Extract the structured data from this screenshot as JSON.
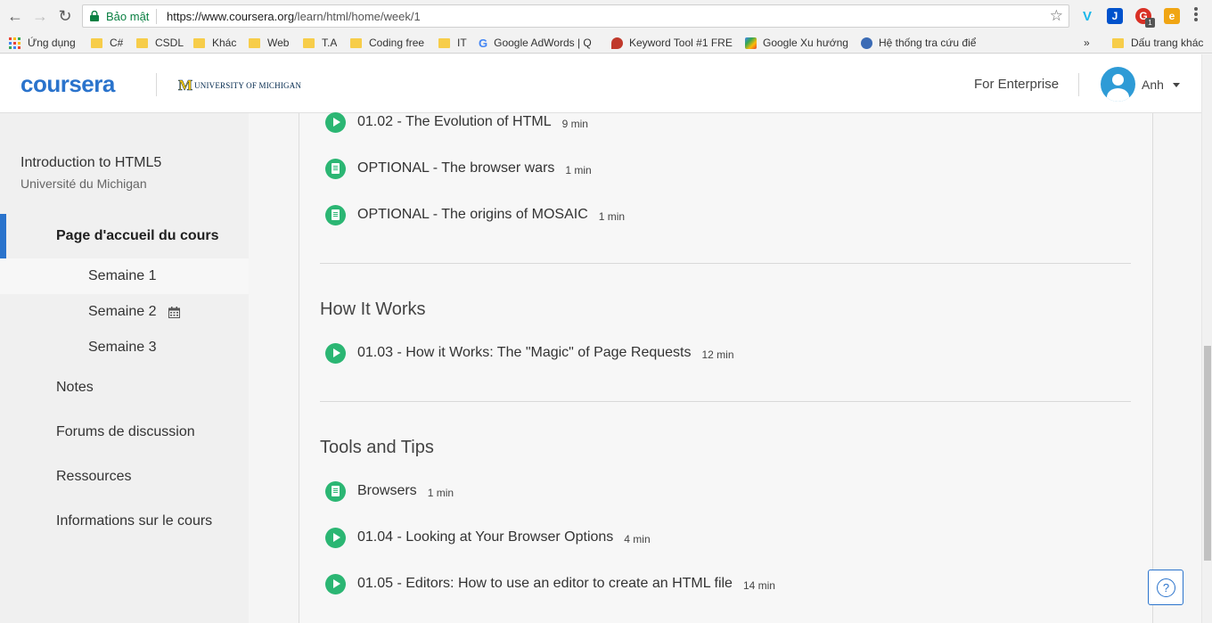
{
  "browser": {
    "secure_label": "Bảo mật",
    "url_host": "https://www.coursera.org",
    "url_path": "/learn/html/home/week/1",
    "extensions": [
      {
        "name": "vimeo",
        "letter": "V",
        "color": "#1ab7ea"
      },
      {
        "name": "jira",
        "letter": "J",
        "color": "#0052cc"
      },
      {
        "name": "pdf",
        "letter": "G",
        "color": "#d93025",
        "badge": "1"
      },
      {
        "name": "evernote",
        "letter": "e",
        "color": "#f0a513"
      }
    ]
  },
  "bookmarks": {
    "apps": "Ứng dụng",
    "items": [
      "C#",
      "CSDL",
      "Khác",
      "Web",
      "T.A",
      "Coding free",
      "IT"
    ],
    "adwords": "Google AdWords | Q",
    "keyword_tool": "Keyword Tool #1 FRE",
    "trends": "Google Xu hướng",
    "lookup": "Hệ thống tra cứu điể",
    "more": "»",
    "other": "Dấu trang khác"
  },
  "header": {
    "logo": "coursera",
    "partner": "UNIVERSITY OF MICHIGAN",
    "partner_mark": "M",
    "enterprise": "For Enterprise",
    "user": "Anh"
  },
  "sidebar": {
    "course_title": "Introduction to HTML5",
    "university": "Université du Michigan",
    "home": "Page d'accueil du cours",
    "weeks": [
      "Semaine 1",
      "Semaine 2",
      "Semaine 3"
    ],
    "links": [
      "Notes",
      "Forums de discussion",
      "Ressources",
      "Informations sur le cours"
    ]
  },
  "main": {
    "items_top": [
      {
        "type": "video",
        "title": "01.02 - The Evolution of HTML",
        "duration": "9 min"
      },
      {
        "type": "reading",
        "title": "OPTIONAL - The browser wars",
        "duration": "1 min"
      },
      {
        "type": "reading",
        "title": "OPTIONAL - The origins of MOSAIC",
        "duration": "1 min"
      }
    ],
    "section_how": "How It Works",
    "items_how": [
      {
        "type": "video",
        "title": "01.03 - How it Works: The \"Magic\" of Page Requests",
        "duration": "12 min"
      }
    ],
    "section_tools": "Tools and Tips",
    "items_tools": [
      {
        "type": "reading",
        "title": "Browsers",
        "duration": "1 min"
      },
      {
        "type": "video",
        "title": "01.04 - Looking at Your Browser Options",
        "duration": "4 min"
      },
      {
        "type": "video",
        "title": "01.05 - Editors: How to use an editor to create an HTML file",
        "duration": "14 min"
      }
    ]
  },
  "help": "?"
}
